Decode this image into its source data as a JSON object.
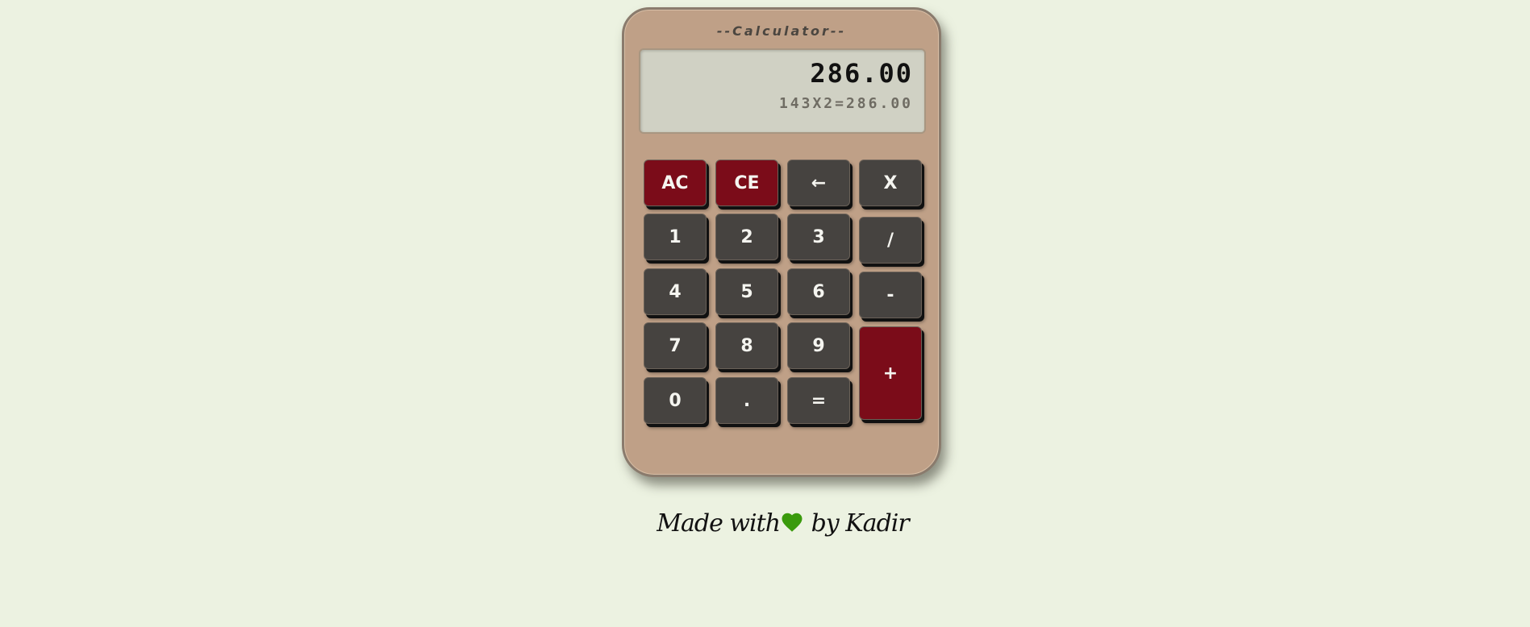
{
  "calculator": {
    "title": "--Calculator--",
    "display": {
      "main": "286.00",
      "history": "143X2=286.00"
    },
    "keys": {
      "ac": "AC",
      "ce": "CE",
      "backspace": "←",
      "multiply": "X",
      "one": "1",
      "two": "2",
      "three": "3",
      "divide": "/",
      "four": "4",
      "five": "5",
      "six": "6",
      "minus": "-",
      "seven": "7",
      "eight": "8",
      "nine": "9",
      "plus": "+",
      "zero": "0",
      "dot": ".",
      "equals": "="
    }
  },
  "footer": {
    "made_with": "Made with",
    "by": "by Kadir",
    "heart_icon": "heart-icon"
  },
  "colors": {
    "background": "#ecf2e1",
    "body": "#bfa087",
    "key_dark": "#464340",
    "key_red": "#7b0c19",
    "display": "#d0d1c4",
    "heart": "#3a9a0c"
  }
}
